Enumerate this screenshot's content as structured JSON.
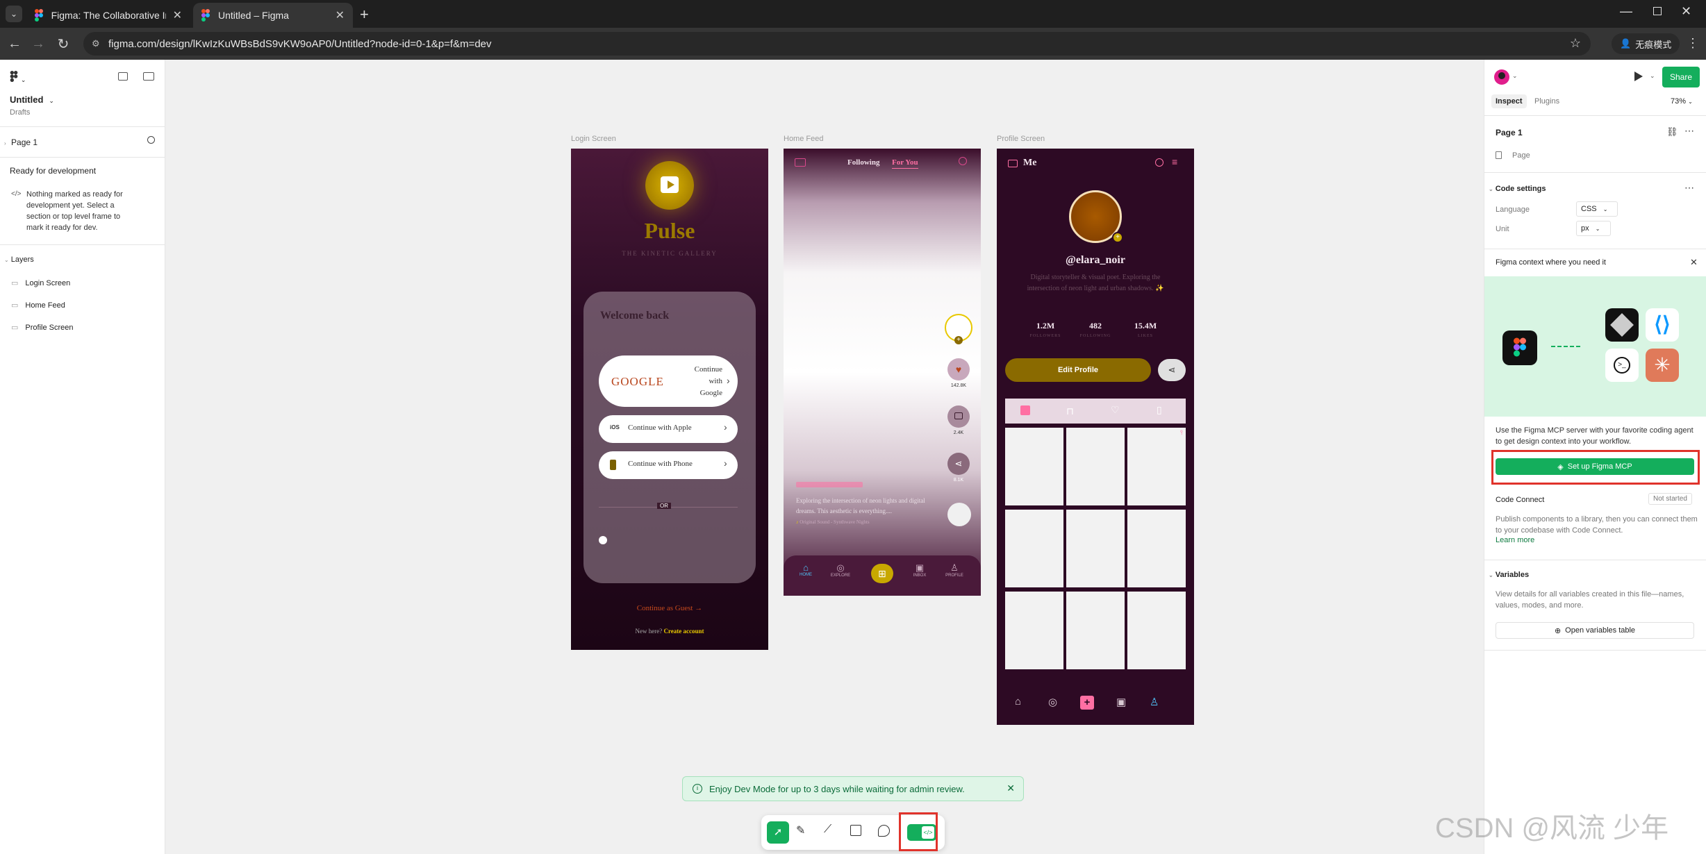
{
  "browser": {
    "tabs": [
      {
        "title": "Figma: The Collaborative Inte"
      },
      {
        "title": "Untitled – Figma"
      }
    ],
    "url": "figma.com/design/lKwIzKuWBsBdS9vKW9oAP0/Untitled?node-id=0-1&p=f&m=dev",
    "incognito_label": "无痕模式"
  },
  "left_panel": {
    "file_name": "Untitled",
    "file_location": "Drafts",
    "page": "Page 1",
    "ready_title": "Ready for development",
    "ready_desc": "Nothing marked as ready for development yet. Select a section or top level frame to mark it ready for dev.",
    "layers_title": "Layers",
    "layers": [
      "Login Screen",
      "Home Feed",
      "Profile Screen"
    ]
  },
  "canvas": {
    "login": {
      "label": "Login Screen",
      "app_name": "Pulse",
      "tagline": "THE KINETIC GALLERY",
      "welcome": "Welcome back",
      "google_logo": "GOOGLE",
      "google_btn": "Continue with Google",
      "apple_btn": "Continue with Apple",
      "ios_tag": "iOS",
      "phone_btn": "Continue with Phone",
      "or": "OR",
      "guest": "Continue as Guest →",
      "new_here": "New here?",
      "create_account": "Create account"
    },
    "home": {
      "label": "Home Feed",
      "tab_following": "Following",
      "tab_foryou": "For You",
      "likes": "142.8K",
      "comments": "2.4K",
      "shares": "8.1K",
      "caption": "Exploring the intersection of neon lights and digital dreams. This aesthetic is everything....",
      "sound": "Original Sound - Synthwave Nights",
      "nav": [
        "HOME",
        "EXPLORE",
        "INBOX",
        "PROFILE"
      ]
    },
    "profile": {
      "label": "Profile Screen",
      "title": "Me",
      "username": "@elara_noir",
      "bio": "Digital storyteller & visual poet. Exploring the intersection of neon light and urban shadows. ✨",
      "stats": [
        {
          "value": "1.2M",
          "label": "FOLLOWERS"
        },
        {
          "value": "482",
          "label": "FOLLOWING"
        },
        {
          "value": "15.4M",
          "label": "LIKES"
        }
      ],
      "edit_btn": "Edit Profile"
    },
    "toast": "Enjoy Dev Mode for up to 3 days while waiting for admin review."
  },
  "right_panel": {
    "share": "Share",
    "tabs": [
      "Inspect",
      "Plugins"
    ],
    "zoom": "73%",
    "page_title": "Page 1",
    "page_type": "Page",
    "code_settings": "Code settings",
    "language_label": "Language",
    "language_value": "CSS",
    "unit_label": "Unit",
    "unit_value": "px",
    "mcp_title": "Figma context where you need it",
    "mcp_desc": "Use the Figma MCP server with your favorite coding agent to get design context into your workflow.",
    "mcp_btn": "Set up Figma MCP",
    "code_connect": "Code Connect",
    "code_connect_status": "Not started",
    "code_connect_desc": "Publish components to a library, then you can connect them to your codebase with Code Connect.",
    "learn_more": "Learn more",
    "variables": "Variables",
    "variables_desc": "View details for all variables created in this file—names, values, modes, and more.",
    "variables_btn": "Open variables table"
  },
  "watermark": "CSDN @风流 少年",
  "colors": {
    "accent": "#14ae5c",
    "figma_blue": "#0d99ff",
    "gold": "#d4af37",
    "pink": "#ff6fa3",
    "highlight": "#e0332b"
  }
}
